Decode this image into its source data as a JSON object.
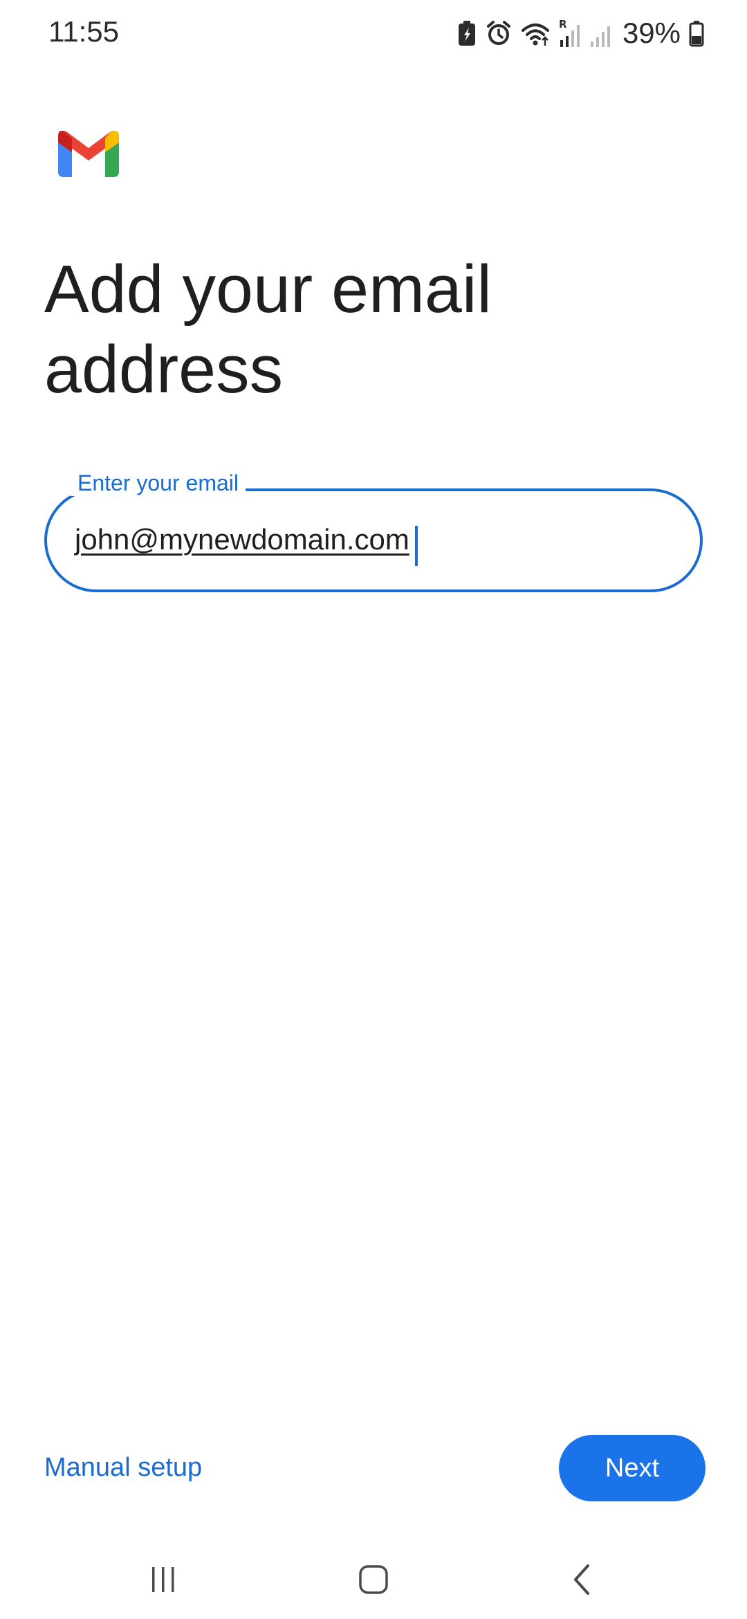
{
  "status_bar": {
    "time": "11:55",
    "battery_percent": "39%",
    "icons": [
      "battery-saver-icon",
      "alarm-icon",
      "wifi-icon",
      "signal-roaming-icon",
      "signal-icon",
      "battery-icon"
    ]
  },
  "app": {
    "logo": "gmail-logo"
  },
  "main": {
    "title": "Add your email address",
    "email_field": {
      "label": "Enter your email",
      "value": "john@mynewdomain.com"
    }
  },
  "actions": {
    "manual_setup_label": "Manual setup",
    "next_label": "Next"
  },
  "nav_bar": {
    "icons": [
      "recent-apps-icon",
      "home-icon",
      "back-icon"
    ]
  },
  "colors": {
    "accent": "#1a73e8",
    "field_border": "#1a6bd2",
    "text": "#1f1f1f",
    "background": "#ffffff",
    "gmail_red": "#ea4335",
    "gmail_blue": "#4285f4",
    "gmail_green": "#34a853",
    "gmail_yellow": "#fbbc04"
  }
}
